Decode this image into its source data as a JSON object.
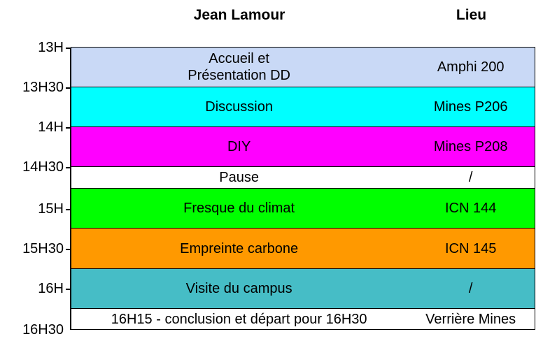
{
  "headers": {
    "event": "Jean Lamour",
    "place": "Lieu"
  },
  "time_ticks": [
    "13H",
    "13H30",
    "14H",
    "14H30",
    "15H",
    "15H30",
    "16H",
    "16H30"
  ],
  "rows": [
    {
      "event_line1": "Accueil et",
      "event_line2": "Présentation DD",
      "place": "Amphi 200",
      "color": "#c9d9f6"
    },
    {
      "event_line1": "Discussion",
      "event_line2": "",
      "place": "Mines P206",
      "color": "#00ffff"
    },
    {
      "event_line1": "DIY",
      "event_line2": "",
      "place": "Mines P208",
      "color": "#ff00ff"
    },
    {
      "event_line1": "Pause",
      "event_line2": "",
      "place": "/",
      "color": "#ffffff"
    },
    {
      "event_line1": "Fresque du climat",
      "event_line2": "",
      "place": "ICN 144",
      "color": "#00ff00"
    },
    {
      "event_line1": "Empreinte carbone",
      "event_line2": "",
      "place": "ICN 145",
      "color": "#ff9900"
    },
    {
      "event_line1": "Visite du campus",
      "event_line2": "",
      "place": "/",
      "color": "#46bdc6"
    },
    {
      "event_line1": "16H15 - conclusion et départ pour 16H30",
      "event_line2": "",
      "place": "Verrière Mines",
      "color": "#ffffff"
    }
  ]
}
